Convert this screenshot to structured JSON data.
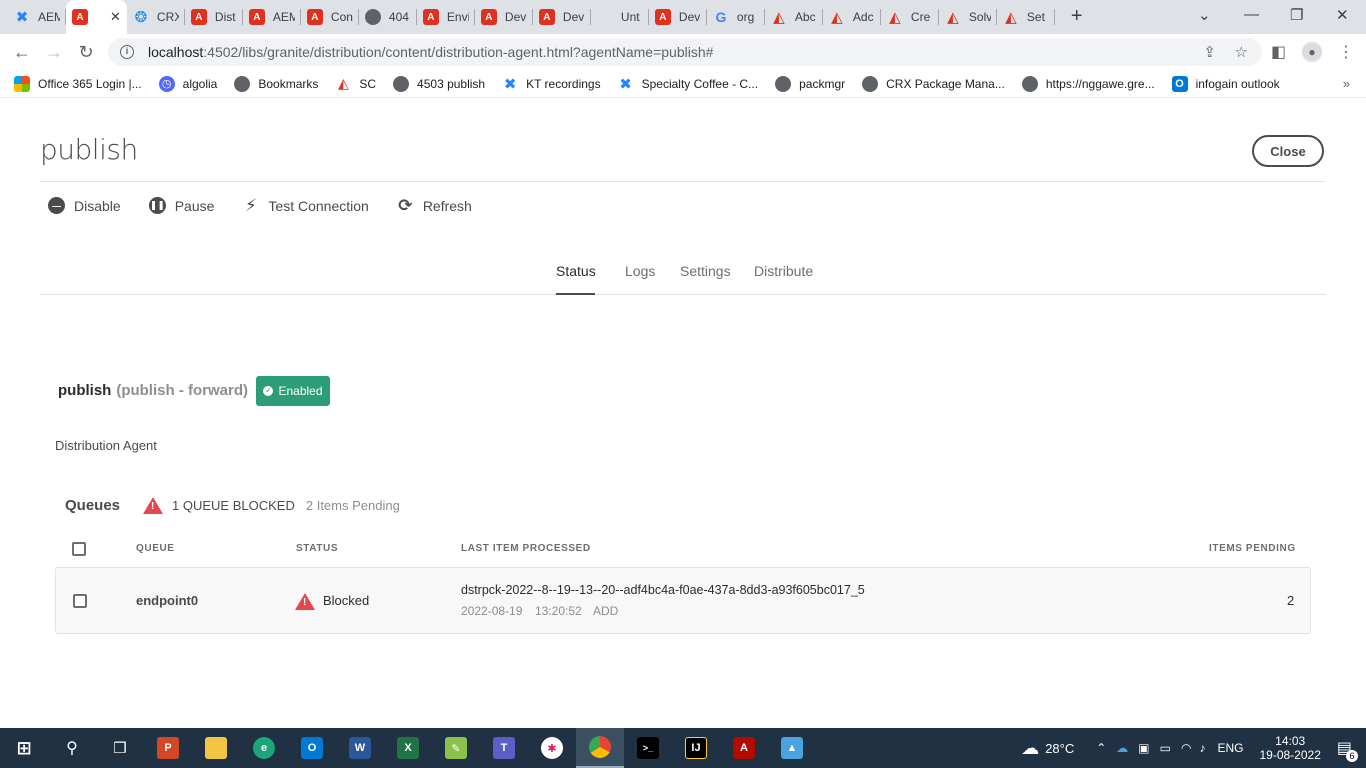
{
  "browser": {
    "tabs": [
      {
        "label": "AEM",
        "icon": "confluence-icon"
      },
      {
        "label": "",
        "icon": "adobe-icon",
        "active": true
      },
      {
        "label": "CRX",
        "icon": "crx-icon"
      },
      {
        "label": "Dist",
        "icon": "adobe-icon"
      },
      {
        "label": "AEM",
        "icon": "adobe-icon"
      },
      {
        "label": "Con",
        "icon": "adobe-icon"
      },
      {
        "label": "404",
        "icon": "globe-icon"
      },
      {
        "label": "Envi",
        "icon": "adobe-icon"
      },
      {
        "label": "Dev",
        "icon": "adobe-icon"
      },
      {
        "label": "Dev",
        "icon": "adobe-icon"
      },
      {
        "label": "Unt",
        "icon": "blank-icon"
      },
      {
        "label": "Dev",
        "icon": "adobe-icon"
      },
      {
        "label": "org",
        "icon": "google-icon"
      },
      {
        "label": "Abc",
        "icon": "adobe-icon"
      },
      {
        "label": "Adc",
        "icon": "adobe-icon"
      },
      {
        "label": "Cre",
        "icon": "adobe-icon"
      },
      {
        "label": "Solv",
        "icon": "adobe-icon"
      },
      {
        "label": "Set",
        "icon": "adobe-icon"
      }
    ],
    "url_host": "localhost",
    "url_path": ":4502/libs/granite/distribution/content/distribution-agent.html?agentName=publish#",
    "bookmarks": [
      {
        "label": "Office 365 Login |...",
        "icon": "microsoft-icon"
      },
      {
        "label": "algolia",
        "icon": "algolia-icon"
      },
      {
        "label": "Bookmarks",
        "icon": "globe-icon"
      },
      {
        "label": "SC",
        "icon": "adobe-icon"
      },
      {
        "label": "4503 publish",
        "icon": "globe-icon"
      },
      {
        "label": "KT recordings",
        "icon": "confluence-icon"
      },
      {
        "label": "Specialty Coffee - C...",
        "icon": "confluence-icon"
      },
      {
        "label": "packmgr",
        "icon": "globe-icon"
      },
      {
        "label": "CRX Package Mana...",
        "icon": "globe-icon"
      },
      {
        "label": "https://nggawe.gre...",
        "icon": "globe-icon"
      },
      {
        "label": "infogain outlook",
        "icon": "outlook-icon"
      }
    ]
  },
  "page": {
    "title": "publish",
    "close_label": "Close",
    "actions": [
      {
        "label": "Disable",
        "icon": "disable-icon"
      },
      {
        "label": "Pause",
        "icon": "pause-icon"
      },
      {
        "label": "Test Connection",
        "icon": "plug-icon"
      },
      {
        "label": "Refresh",
        "icon": "refresh-icon"
      }
    ],
    "tabs": [
      "Status",
      "Logs",
      "Settings",
      "Distribute"
    ],
    "selected_tab": "Status",
    "agent": {
      "name": "publish",
      "subtitle": "(publish - forward)",
      "status_badge": "Enabled",
      "description": "Distribution Agent"
    },
    "queues": {
      "title": "Queues",
      "blocked_summary": "1 QUEUE BLOCKED",
      "pending_summary": "2 Items Pending",
      "columns": [
        "QUEUE",
        "STATUS",
        "LAST ITEM PROCESSED",
        "ITEMS PENDING"
      ],
      "rows": [
        {
          "queue": "endpoint0",
          "status": "Blocked",
          "last_item_id": "dstrpck-2022--8--19--13--20--adf4bc4a-f0ae-437a-8dd3-a93f605bc017_5",
          "last_item_date": "2022-08-19",
          "last_item_time": "13:20:52",
          "last_item_action": "ADD",
          "items_pending": "2"
        }
      ]
    }
  },
  "taskbar": {
    "weather": "28°C",
    "language": "ENG",
    "time": "14:03",
    "date": "19-08-2022",
    "notifications": "6"
  },
  "colors": {
    "enabled_green": "#2d9d78",
    "warning_red": "#e34850",
    "tabstrip": "#dee1e6",
    "taskbar": "#1f3143"
  }
}
